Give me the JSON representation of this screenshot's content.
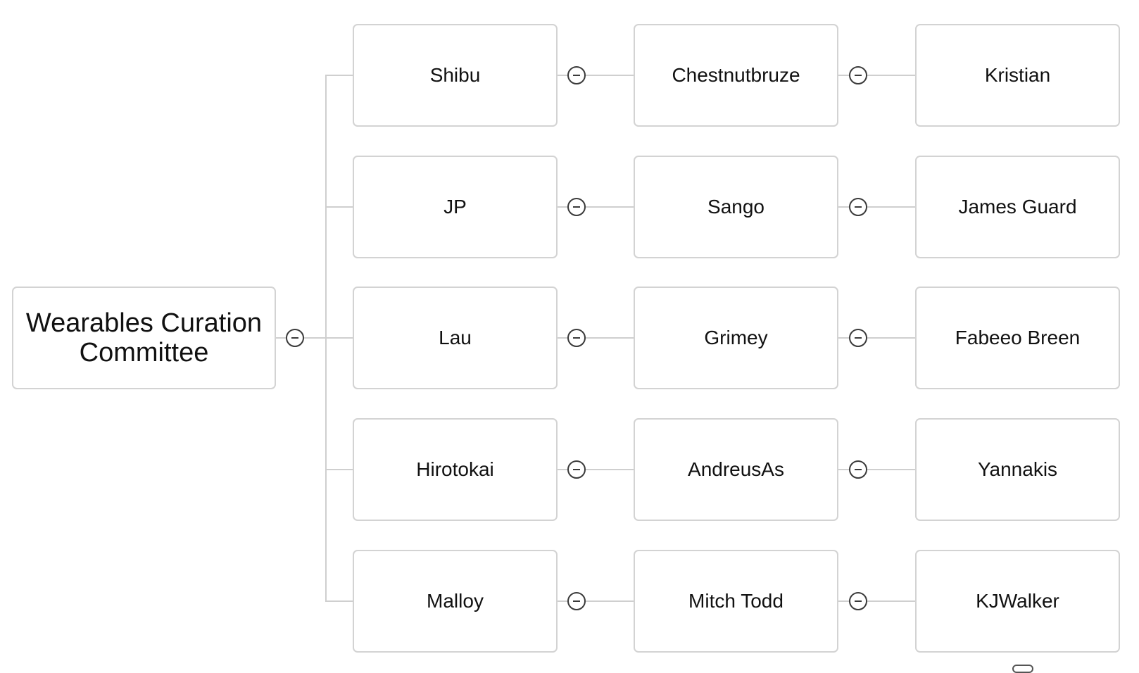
{
  "diagram": {
    "root": {
      "label": "Wearables Curation Committee"
    },
    "rows": [
      {
        "level1": "Shibu",
        "level2": "Chestnutbruze",
        "level3": "Kristian"
      },
      {
        "level1": "JP",
        "level2": "Sango",
        "level3": "James Guard"
      },
      {
        "level1": "Lau",
        "level2": "Grimey",
        "level3": "Fabeeo Breen"
      },
      {
        "level1": "Hirotokai",
        "level2": "AndreusAs",
        "level3": "Yannakis"
      },
      {
        "level1": "Malloy",
        "level2": "Mitch Todd",
        "level3": "KJWalker"
      }
    ],
    "toggle_icon": "collapse-minus-icon"
  }
}
